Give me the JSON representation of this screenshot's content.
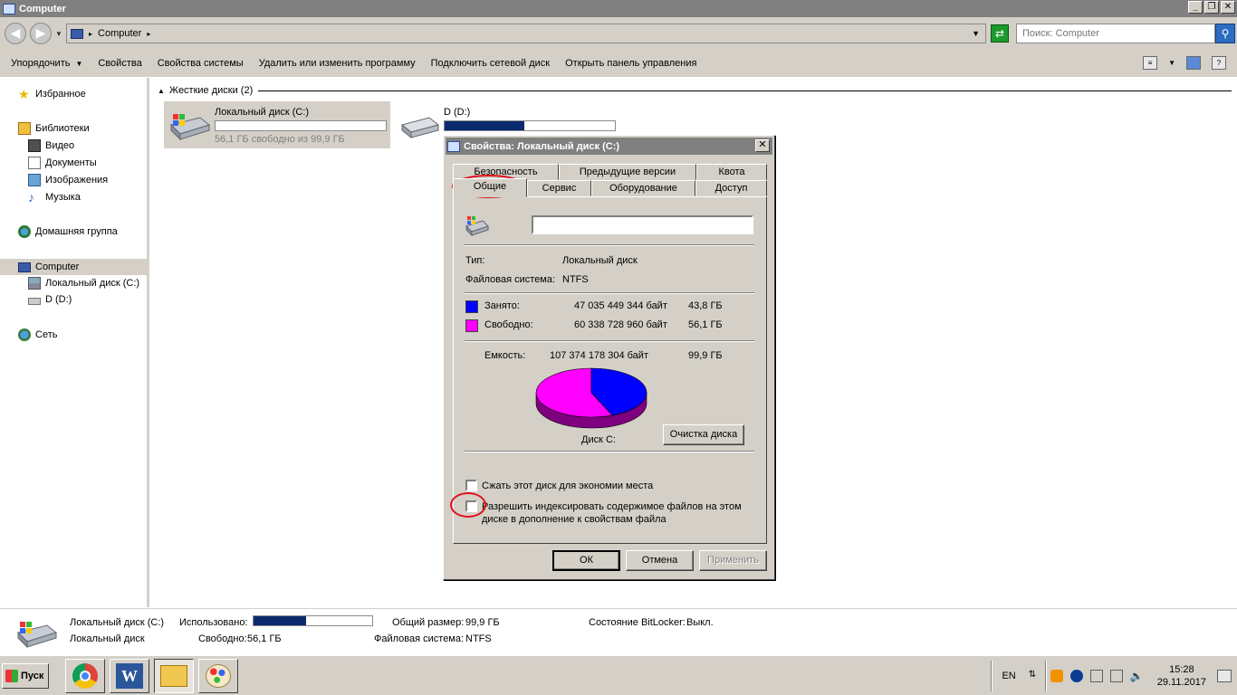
{
  "window": {
    "title": "Computer"
  },
  "address": {
    "crumb": "Computer",
    "search_placeholder": "Поиск: Computer"
  },
  "toolbar": {
    "organize": "Упорядочить",
    "properties": "Свойства",
    "system_properties": "Свойства системы",
    "uninstall": "Удалить или изменить программу",
    "map_drive": "Подключить сетевой диск",
    "control_panel": "Открыть панель управления"
  },
  "sidebar": {
    "favorites": "Избранное",
    "libraries": "Библиотеки",
    "video": "Видео",
    "documents": "Документы",
    "images": "Изображения",
    "music": "Музыка",
    "homegroup": "Домашняя группа",
    "computer": "Computer",
    "drive_c": "Локальный диск (C:)",
    "drive_d": "D (D:)",
    "network": "Сеть"
  },
  "content": {
    "group_header": "Жесткие диски (2)",
    "drive_c": {
      "name": "Локальный диск (C:)",
      "free_text": "56,1 ГБ свободно из 99,9 ГБ",
      "used_fraction": 0.0
    },
    "drive_d": {
      "name": "D (D:)",
      "used_fraction": 0.47
    }
  },
  "details": {
    "name": "Локальный диск (C:)",
    "used_label": "Использовано:",
    "used_fraction": 0.44,
    "type": "Локальный диск",
    "free_label": "Свободно:",
    "free_value": "56,1 ГБ",
    "total_label": "Общий размер:",
    "total_value": "99,9 ГБ",
    "fs_label": "Файловая система:",
    "fs_value": "NTFS",
    "bitlocker_label": "Состояние BitLocker:",
    "bitlocker_value": "Выкл."
  },
  "dialog": {
    "title": "Свойства: Локальный диск (C:)",
    "tabs_row1": [
      "Безопасность",
      "Предыдущие версии",
      "Квота"
    ],
    "tabs_row2": [
      "Общие",
      "Сервис",
      "Оборудование",
      "Доступ"
    ],
    "active_tab": "Общие",
    "name_value": "",
    "type_label": "Тип:",
    "type_value": "Локальный диск",
    "fs_label": "Файловая система:",
    "fs_value": "NTFS",
    "used_label": "Занято:",
    "used_bytes": "47 035 449 344 байт",
    "used_gb": "43,8 ГБ",
    "free_label": "Свободно:",
    "free_bytes": "60 338 728 960 байт",
    "free_gb": "56,1 ГБ",
    "capacity_label": "Емкость:",
    "capacity_bytes": "107 374 178 304 байт",
    "capacity_gb": "99,9 ГБ",
    "used_fraction": 0.438,
    "disk_label": "Диск C:",
    "cleanup_button": "Очистка диска",
    "compress_label": "Сжать этот диск для экономии места",
    "index_label_line1": "Разрешить индексировать содержимое файлов на этом",
    "index_label_line2": "диске в дополнение к свойствам файла",
    "ok": "ОК",
    "cancel": "Отмена",
    "apply": "Применить",
    "colors": {
      "used": "#0000ff",
      "free": "#ff00ff",
      "used_side": "#00007f",
      "free_side": "#7f007f"
    }
  },
  "taskbar": {
    "start": "Пуск",
    "lang": "EN",
    "time": "15:28",
    "date": "29.11.2017"
  }
}
